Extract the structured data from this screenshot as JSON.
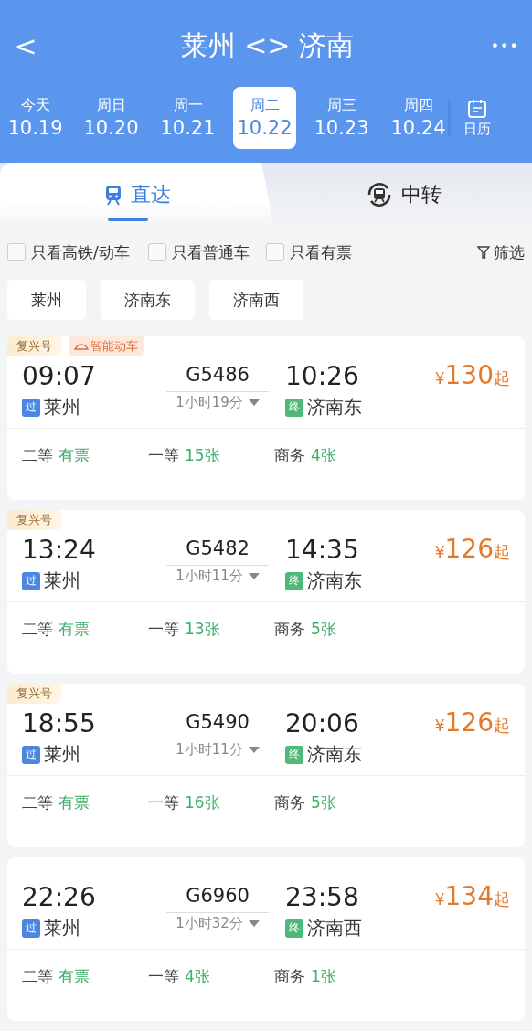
{
  "header": {
    "back": "<",
    "title": "莱州 <> 济南",
    "more": "•••"
  },
  "dates": [
    {
      "weekday": "今天",
      "date": "10.19",
      "selected": false
    },
    {
      "weekday": "周日",
      "date": "10.20",
      "selected": false
    },
    {
      "weekday": "周一",
      "date": "10.21",
      "selected": false
    },
    {
      "weekday": "周二",
      "date": "10.22",
      "selected": true
    },
    {
      "weekday": "周三",
      "date": "10.23",
      "selected": false
    },
    {
      "weekday": "周四",
      "date": "10.24",
      "selected": false
    }
  ],
  "calendar": {
    "label": "日历"
  },
  "tabs": [
    {
      "label": "直达",
      "selected": true
    },
    {
      "label": "中转",
      "selected": false
    }
  ],
  "filters": [
    {
      "label": "只看高铁/动车",
      "checked": false
    },
    {
      "label": "只看普通车",
      "checked": false
    },
    {
      "label": "只看有票",
      "checked": false
    }
  ],
  "filter_button": "筛选",
  "stations": [
    "莱州",
    "济南东",
    "济南西"
  ],
  "trains": [
    {
      "tags": [
        {
          "label": "复兴号",
          "kind": "brand"
        },
        {
          "label": "智能动车",
          "kind": "smart"
        }
      ],
      "depart": "09:07",
      "number": "G5486",
      "arrive": "10:26",
      "from_badge": {
        "label": "过",
        "kind": "pass"
      },
      "from": "莱州",
      "duration": "1小时19分",
      "to_badge": {
        "label": "终",
        "kind": "end"
      },
      "to": "济南东",
      "price_symbol": "¥",
      "price": "130",
      "price_suffix": "起",
      "seats": [
        {
          "class": "二等",
          "avail": "有票"
        },
        {
          "class": "一等",
          "avail": "15张"
        },
        {
          "class": "商务",
          "avail": "4张"
        }
      ]
    },
    {
      "tags": [
        {
          "label": "复兴号",
          "kind": "brand"
        }
      ],
      "depart": "13:24",
      "number": "G5482",
      "arrive": "14:35",
      "from_badge": {
        "label": "过",
        "kind": "pass"
      },
      "from": "莱州",
      "duration": "1小时11分",
      "to_badge": {
        "label": "终",
        "kind": "end"
      },
      "to": "济南东",
      "price_symbol": "¥",
      "price": "126",
      "price_suffix": "起",
      "seats": [
        {
          "class": "二等",
          "avail": "有票"
        },
        {
          "class": "一等",
          "avail": "13张"
        },
        {
          "class": "商务",
          "avail": "5张"
        }
      ]
    },
    {
      "tags": [
        {
          "label": "复兴号",
          "kind": "brand"
        }
      ],
      "depart": "18:55",
      "number": "G5490",
      "arrive": "20:06",
      "from_badge": {
        "label": "过",
        "kind": "pass"
      },
      "from": "莱州",
      "duration": "1小时11分",
      "to_badge": {
        "label": "终",
        "kind": "end"
      },
      "to": "济南东",
      "price_symbol": "¥",
      "price": "126",
      "price_suffix": "起",
      "seats": [
        {
          "class": "二等",
          "avail": "有票"
        },
        {
          "class": "一等",
          "avail": "16张"
        },
        {
          "class": "商务",
          "avail": "5张"
        }
      ]
    },
    {
      "depart": "22:26",
      "number": "G6960",
      "arrive": "23:58",
      "from_badge": {
        "label": "过",
        "kind": "pass"
      },
      "from": "莱州",
      "duration": "1小时32分",
      "to_badge": {
        "label": "终",
        "kind": "end"
      },
      "to": "济南西",
      "price_symbol": "¥",
      "price": "134",
      "price_suffix": "起",
      "seats": [
        {
          "class": "二等",
          "avail": "有票"
        },
        {
          "class": "一等",
          "avail": "4张"
        },
        {
          "class": "商务",
          "avail": "1张"
        }
      ]
    }
  ]
}
